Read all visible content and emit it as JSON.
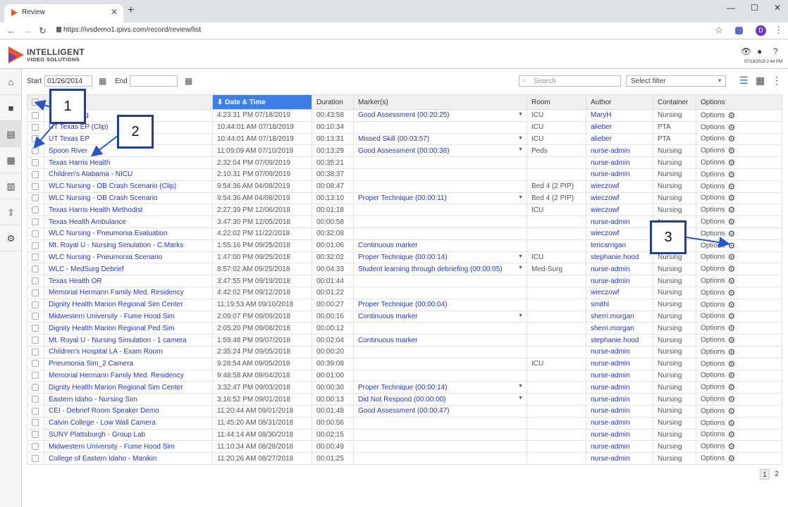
{
  "browser": {
    "tab_title": "Review",
    "url": "https://ivsdemo1.ipivs.com/record/review/list",
    "profile_initial": "D"
  },
  "app": {
    "logo_line1": "INTELLIGENT",
    "logo_line2": "VIDEO SOLUTIONS",
    "datetime": "07/19/2019 2:44 PM"
  },
  "filters": {
    "start_label": "Start",
    "start_value": "01/26/2014",
    "end_label": "End",
    "end_value": "",
    "search_placeholder": "Search",
    "select_filter": "Select filter"
  },
  "table": {
    "columns": [
      "Name",
      "Date & Time",
      "Duration",
      "Marker(s)",
      "Room",
      "Author",
      "Container",
      "Options"
    ],
    "options_label": "Options",
    "rows": [
      {
        "name": "... Recording",
        "date": "4:23:31 PM 07/18/2019",
        "duration": "00:43:58",
        "marker": "Good Assessment (00:20:25)",
        "dd": true,
        "room": "ICU",
        "author": "MaryH",
        "container": "Nursing"
      },
      {
        "name": "UT Texas EP (Clip)",
        "date": "10:44:01 AM 07/18/2019",
        "duration": "00:10:34",
        "marker": "",
        "dd": false,
        "room": "ICU",
        "author": "alieber",
        "container": "PTA"
      },
      {
        "name": "UT Texas EP",
        "date": "10:44:01 AM 07/18/2019",
        "duration": "00:13:31",
        "marker": "Missed Skill (00:03:57)",
        "dd": true,
        "room": "ICU",
        "author": "alieber",
        "container": "PTA"
      },
      {
        "name": "Spoon River",
        "date": "11:09:09 AM 07/10/2019",
        "duration": "00:13:29",
        "marker": "Good Assessment (00:00:38)",
        "dd": true,
        "room": "Peds",
        "author": "nurse-admin",
        "container": "Nursing"
      },
      {
        "name": "Texas Harris Health",
        "date": "2:32:04 PM 07/09/2019",
        "duration": "00:35:21",
        "marker": "",
        "dd": false,
        "room": "",
        "author": "nurse-admin",
        "container": "Nursing"
      },
      {
        "name": "Children's Alabama - NICU",
        "date": "2:10:31 PM 07/09/2019",
        "duration": "00:38:37",
        "marker": "",
        "dd": false,
        "room": "",
        "author": "nurse-admin",
        "container": "Nursing"
      },
      {
        "name": "WLC Nursing - OB Crash Scenario (Clip)",
        "date": "9:54:36 AM 04/08/2019",
        "duration": "00:08:47",
        "marker": "",
        "dd": false,
        "room": "Bed 4 (2 PIP)",
        "author": "wieczowf",
        "container": "Nursing"
      },
      {
        "name": "WLC Nursing - OB Crash Scenario",
        "date": "9:54:36 AM 04/08/2019",
        "duration": "00:13:10",
        "marker": "Proper Technique (00:00:11)",
        "dd": true,
        "room": "Bed 4 (2 PIP)",
        "author": "wieczowf",
        "container": "Nursing"
      },
      {
        "name": "Texas Harris Health Methodist",
        "date": "2:27:39 PM 12/06/2018",
        "duration": "00:01:18",
        "marker": "",
        "dd": false,
        "room": "ICU",
        "author": "wieczowf",
        "container": "Nursing"
      },
      {
        "name": "Texas Health Ambulance",
        "date": "3:47:30 PM 12/05/2018",
        "duration": "00:00:58",
        "marker": "",
        "dd": false,
        "room": "",
        "author": "nurse-admin",
        "container": "Nursing"
      },
      {
        "name": "WLC Nursing - Pneumonia Evaluation",
        "date": "4:22:02 PM 11/22/2018",
        "duration": "00:32:08",
        "marker": "",
        "dd": false,
        "room": "",
        "author": "wieczowf",
        "container": "Nursing"
      },
      {
        "name": "Mt. Royal U - Nursing Simulation - C.Marks",
        "date": "1:55:16 PM 09/25/2018",
        "duration": "00:01:06",
        "marker": "Continuous marker",
        "dd": false,
        "room": "",
        "author": "tericarrigan",
        "container": "Nursing"
      },
      {
        "name": "WLC Nursing - Pneumonia Scenario",
        "date": "1:47:00 PM 09/25/2018",
        "duration": "00:32:02",
        "marker": "Proper Technique (00:00:14)",
        "dd": true,
        "room": "ICU",
        "author": "stephanie.hood",
        "container": "Nursing"
      },
      {
        "name": "WLC - MedSurg Debrief",
        "date": "8:57:02 AM 09/25/2018",
        "duration": "00:04:33",
        "marker": "Student learning through debriefing (00:00:05)",
        "dd": true,
        "room": "Med-Surg",
        "author": "nurse-admin",
        "container": "Nursing"
      },
      {
        "name": "Texas Health OR",
        "date": "3:47:55 PM 09/19/2018",
        "duration": "00:01:44",
        "marker": "",
        "dd": false,
        "room": "",
        "author": "nurse-admin",
        "container": "Nursing"
      },
      {
        "name": "Memorial Hermann Family Med. Residency",
        "date": "4:42:02 PM 09/12/2018",
        "duration": "00:01:22",
        "marker": "",
        "dd": false,
        "room": "",
        "author": "wieczowf",
        "container": "Nursing"
      },
      {
        "name": "Dignity Health Marion Regional Sim Center",
        "date": "11:19:53 AM 09/10/2018",
        "duration": "00:00:27",
        "marker": "Proper Technique (00:00:04)",
        "dd": false,
        "room": "",
        "author": "smithl",
        "container": "Nursing"
      },
      {
        "name": "Midwestern University - Fume Hood Sim",
        "date": "2:09:07 PM 09/09/2018",
        "duration": "00:00:16",
        "marker": "Continuous marker",
        "dd": true,
        "room": "",
        "author": "sherri.morgan",
        "container": "Nursing"
      },
      {
        "name": "Dignity Health Marion Regional Ped Sim",
        "date": "2:05:20 PM 09/08/2018",
        "duration": "00:00:12",
        "marker": "",
        "dd": false,
        "room": "",
        "author": "sherri.morgan",
        "container": "Nursing"
      },
      {
        "name": "Mt. Royal U - Nursing Simulation - 1 camera",
        "date": "1:59:48 PM 09/07/2018",
        "duration": "00:02:04",
        "marker": "Continuous marker",
        "dd": false,
        "room": "",
        "author": "stephanie.hood",
        "container": "Nursing"
      },
      {
        "name": "Children's Hospital LA - Exam Room",
        "date": "2:35:24 PM 09/05/2018",
        "duration": "00:00:20",
        "marker": "",
        "dd": false,
        "room": "",
        "author": "nurse-admin",
        "container": "Nursing"
      },
      {
        "name": "Pneumonia Sim_2 Camera",
        "date": "9:28:54 AM 09/05/2018",
        "duration": "00:39:08",
        "marker": "",
        "dd": false,
        "room": "ICU",
        "author": "nurse-admin",
        "container": "Nursing"
      },
      {
        "name": "Memorial Hermann Family Med. Residency",
        "date": "9:48:58 AM 09/04/2018",
        "duration": "00:01:00",
        "marker": "",
        "dd": false,
        "room": "",
        "author": "nurse-admin",
        "container": "Nursing"
      },
      {
        "name": "Dignity Health Marion Regional Sim Center",
        "date": "3:32:47 PM 09/03/2018",
        "duration": "00:00:30",
        "marker": "Proper Technique (00:00:14)",
        "dd": true,
        "room": "",
        "author": "nurse-admin",
        "container": "Nursing"
      },
      {
        "name": "Eastern Idaho - Nursing Sim",
        "date": "3:16:52 PM 09/01/2018",
        "duration": "00:00:13",
        "marker": "Did Not Respond (00:00:00)",
        "dd": true,
        "room": "",
        "author": "nurse-admin",
        "container": "Nursing"
      },
      {
        "name": "CEI - Debrief Room Speaker Demo",
        "date": "11:20:44 AM 09/01/2018",
        "duration": "00:01:48",
        "marker": "Good Assessment (00:00:47)",
        "dd": false,
        "room": "",
        "author": "nurse-admin",
        "container": "Nursing"
      },
      {
        "name": "Calvin College - Low Wall Camera",
        "date": "11:45:20 AM 08/31/2018",
        "duration": "00:00:56",
        "marker": "",
        "dd": false,
        "room": "",
        "author": "nurse-admin",
        "container": "Nursing"
      },
      {
        "name": "SUNY Plattsburgh - Group Lab",
        "date": "11:44:14 AM 08/30/2018",
        "duration": "00:02:15",
        "marker": "",
        "dd": false,
        "room": "",
        "author": "nurse-admin",
        "container": "Nursing"
      },
      {
        "name": "Midwestern University - Fume Hood Sim",
        "date": "11:10:34 AM 08/28/2018",
        "duration": "00:00:49",
        "marker": "",
        "dd": false,
        "room": "",
        "author": "nurse-admin",
        "container": "Nursing"
      },
      {
        "name": "College of Eastern Idaho - Manikin",
        "date": "11:20:26 AM 08/27/2018",
        "duration": "00:01:25",
        "marker": "",
        "dd": false,
        "room": "",
        "author": "nurse-admin",
        "container": "Nursing"
      }
    ]
  },
  "pagination": {
    "pages": [
      "1",
      "2"
    ],
    "current": "1"
  },
  "callouts": [
    "1",
    "2",
    "3"
  ],
  "colors": {
    "accent": "#3d7fe6",
    "link": "#2236c9",
    "brand": "#e8562a",
    "callout_border": "#1f3f99"
  }
}
